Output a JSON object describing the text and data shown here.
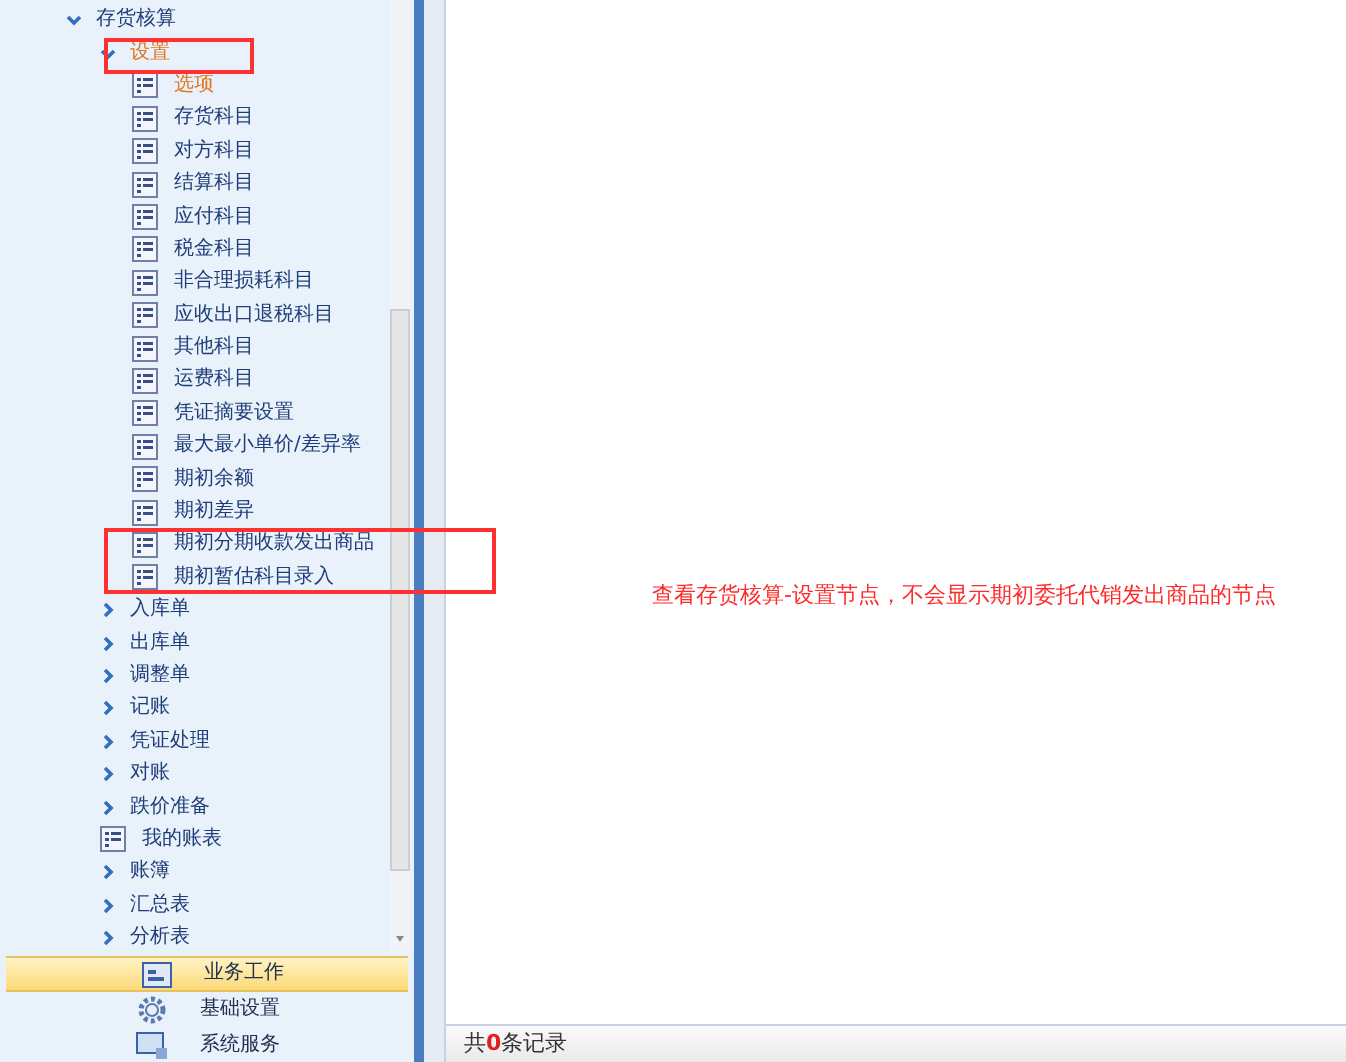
{
  "tree": [
    {
      "label": "存货核算",
      "selected": false,
      "expanded": true,
      "children": [
        {
          "label": "设置",
          "selected": true,
          "expanded": true,
          "children": [
            {
              "label": "选项",
              "selected": true
            },
            {
              "label": "存货科目",
              "selected": false
            },
            {
              "label": "对方科目",
              "selected": false
            },
            {
              "label": "结算科目",
              "selected": false
            },
            {
              "label": "应付科目",
              "selected": false
            },
            {
              "label": "税金科目",
              "selected": false
            },
            {
              "label": "非合理损耗科目",
              "selected": false
            },
            {
              "label": "应收出口退税科目",
              "selected": false
            },
            {
              "label": "其他科目",
              "selected": false
            },
            {
              "label": "运费科目",
              "selected": false
            },
            {
              "label": "凭证摘要设置",
              "selected": false
            },
            {
              "label": "最大最小单价/差异率",
              "selected": false
            },
            {
              "label": "期初余额",
              "selected": false
            },
            {
              "label": "期初差异",
              "selected": false
            },
            {
              "label": "期初分期收款发出商品",
              "selected": false
            },
            {
              "label": "期初暂估科目录入",
              "selected": false
            }
          ]
        },
        {
          "label": "入库单",
          "selected": false,
          "expanded": false
        },
        {
          "label": "出库单",
          "selected": false,
          "expanded": false
        },
        {
          "label": "调整单",
          "selected": false,
          "expanded": false
        },
        {
          "label": "记账",
          "selected": false,
          "expanded": false
        },
        {
          "label": "凭证处理",
          "selected": false,
          "expanded": false
        },
        {
          "label": "对账",
          "selected": false,
          "expanded": false
        },
        {
          "label": "跌价准备",
          "selected": false,
          "expanded": false
        },
        {
          "label": "我的账表",
          "selected": false
        },
        {
          "label": "账簿",
          "selected": false,
          "expanded": false
        },
        {
          "label": "汇总表",
          "selected": false,
          "expanded": false
        },
        {
          "label": "分析表",
          "selected": false,
          "expanded": false
        }
      ]
    }
  ],
  "nav": [
    {
      "label": "业务工作",
      "selected": true
    },
    {
      "label": "基础设置",
      "selected": false
    },
    {
      "label": "系统服务",
      "selected": false
    }
  ],
  "note": "查看存货核算-设置节点，不会显示期初委托代销发出商品的节点",
  "status_bar": {
    "prefix": "共",
    "count": "0",
    "suffix": "条记录"
  }
}
